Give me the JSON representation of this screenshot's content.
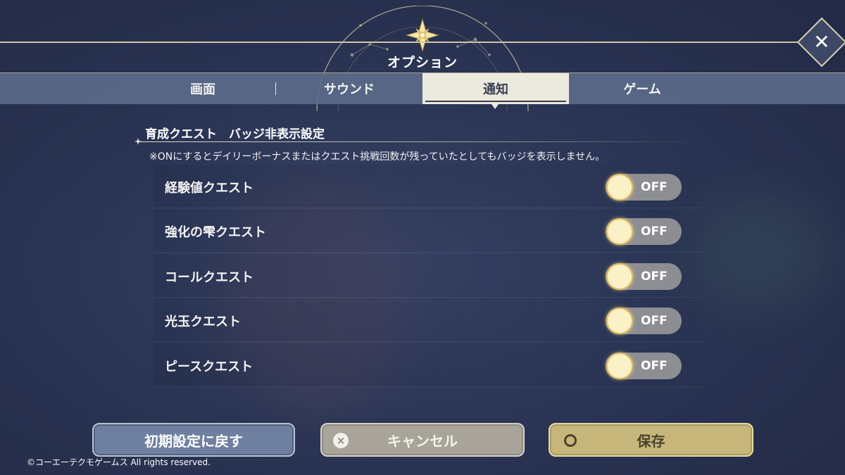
{
  "header": {
    "title": "オプション",
    "close_icon": "close-icon"
  },
  "tabs": [
    {
      "label": "画面",
      "active": false
    },
    {
      "label": "サウンド",
      "active": false
    },
    {
      "label": "通知",
      "active": true
    },
    {
      "label": "ゲーム",
      "active": false
    }
  ],
  "section": {
    "title": "育成クエスト　バッジ非表示設定",
    "note": "※ONにするとデイリーボーナスまたはクエスト挑戦回数が残っていたとしてもバッジを表示しません。"
  },
  "settings": [
    {
      "label": "経験値クエスト",
      "state": "OFF"
    },
    {
      "label": "強化の雫クエスト",
      "state": "OFF"
    },
    {
      "label": "コールクエスト",
      "state": "OFF"
    },
    {
      "label": "光玉クエスト",
      "state": "OFF"
    },
    {
      "label": "ピースクエスト",
      "state": "OFF"
    }
  ],
  "buttons": {
    "reset": "初期設定に戻す",
    "cancel": "キャンセル",
    "cancel_icon": "×",
    "save": "保存"
  },
  "footer": {
    "copyright": "©コーエーテクモゲームス All rights reserved."
  },
  "colors": {
    "accent_gold": "#e0be6a",
    "tab_active_bg": "#ece9df",
    "save_button": "#c7b679",
    "cancel_button": "#a9a49a",
    "reset_button": "#6f7f9f"
  }
}
